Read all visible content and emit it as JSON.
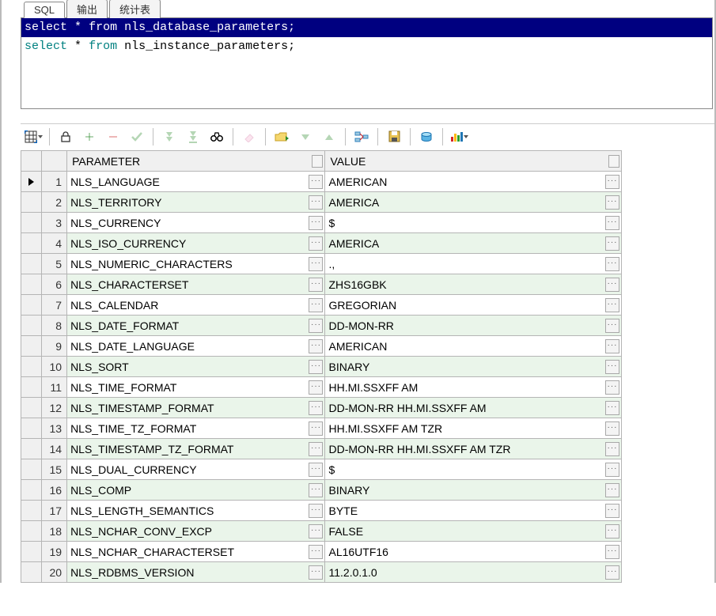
{
  "tabs": {
    "sql": "SQL",
    "output": "输出",
    "stats": "统计表"
  },
  "sql": {
    "line1": {
      "kw1": "select",
      "star": "*",
      "kw2": "from",
      "ident": "nls_database_parameters",
      "semi": ";"
    },
    "line2": {
      "kw1": "select",
      "star": "*",
      "kw2": "from",
      "ident": "nls_instance_parameters",
      "semi": ";"
    }
  },
  "columns": {
    "param": "PARAMETER",
    "value": "VALUE"
  },
  "cell_more": "···",
  "toolbar": {
    "grid": "grid-options",
    "lock": "lock",
    "add": "add-row",
    "remove": "remove-row",
    "commit": "commit",
    "fetch_next": "fetch-next",
    "fetch_all": "fetch-all",
    "find": "find",
    "clear": "clear",
    "export": "query-by-example",
    "up": "up",
    "down": "down",
    "linked": "linked-query",
    "save": "save",
    "print": "refresh",
    "chart": "chart"
  },
  "rows": [
    {
      "n": 1,
      "param": "NLS_LANGUAGE",
      "value": "AMERICAN"
    },
    {
      "n": 2,
      "param": "NLS_TERRITORY",
      "value": "AMERICA"
    },
    {
      "n": 3,
      "param": "NLS_CURRENCY",
      "value": "$"
    },
    {
      "n": 4,
      "param": "NLS_ISO_CURRENCY",
      "value": "AMERICA"
    },
    {
      "n": 5,
      "param": "NLS_NUMERIC_CHARACTERS",
      "value": ".,"
    },
    {
      "n": 6,
      "param": "NLS_CHARACTERSET",
      "value": "ZHS16GBK"
    },
    {
      "n": 7,
      "param": "NLS_CALENDAR",
      "value": "GREGORIAN"
    },
    {
      "n": 8,
      "param": "NLS_DATE_FORMAT",
      "value": "DD-MON-RR"
    },
    {
      "n": 9,
      "param": "NLS_DATE_LANGUAGE",
      "value": "AMERICAN"
    },
    {
      "n": 10,
      "param": "NLS_SORT",
      "value": "BINARY"
    },
    {
      "n": 11,
      "param": "NLS_TIME_FORMAT",
      "value": "HH.MI.SSXFF AM"
    },
    {
      "n": 12,
      "param": "NLS_TIMESTAMP_FORMAT",
      "value": "DD-MON-RR HH.MI.SSXFF AM"
    },
    {
      "n": 13,
      "param": "NLS_TIME_TZ_FORMAT",
      "value": "HH.MI.SSXFF AM TZR"
    },
    {
      "n": 14,
      "param": "NLS_TIMESTAMP_TZ_FORMAT",
      "value": "DD-MON-RR HH.MI.SSXFF AM TZR"
    },
    {
      "n": 15,
      "param": "NLS_DUAL_CURRENCY",
      "value": "$"
    },
    {
      "n": 16,
      "param": "NLS_COMP",
      "value": "BINARY"
    },
    {
      "n": 17,
      "param": "NLS_LENGTH_SEMANTICS",
      "value": "BYTE"
    },
    {
      "n": 18,
      "param": "NLS_NCHAR_CONV_EXCP",
      "value": "FALSE"
    },
    {
      "n": 19,
      "param": "NLS_NCHAR_CHARACTERSET",
      "value": "AL16UTF16"
    },
    {
      "n": 20,
      "param": "NLS_RDBMS_VERSION",
      "value": "11.2.0.1.0"
    }
  ]
}
